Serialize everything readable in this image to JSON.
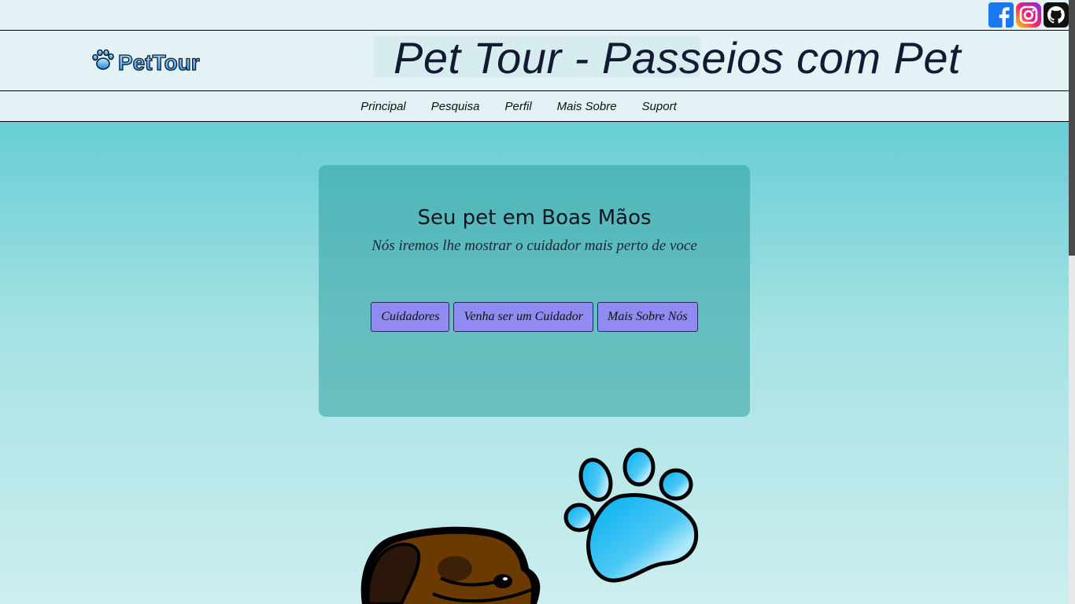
{
  "social": {
    "facebook_icon": "facebook-icon",
    "instagram_icon": "instagram-icon",
    "github_icon": "github-icon"
  },
  "header": {
    "logo_text": "PetTour",
    "title": "Pet Tour - Passeios com Pet"
  },
  "nav": {
    "items": [
      {
        "label": "Principal"
      },
      {
        "label": "Pesquisa"
      },
      {
        "label": "Perfil"
      },
      {
        "label": "Mais Sobre"
      },
      {
        "label": "Suport"
      }
    ]
  },
  "hero": {
    "heading": "Seu pet em Boas Mãos",
    "subheading": "Nós iremos lhe mostrar o cuidador mais perto de voce",
    "buttons": [
      {
        "label": "Cuidadores"
      },
      {
        "label": "Venha ser um Cuidador"
      },
      {
        "label": "Mais Sobre Nós"
      }
    ]
  },
  "colors": {
    "accent_button": "#8f8bf0",
    "paw_blue": "#1aa3f0",
    "background_top": "#4ac9d0",
    "header_bg": "#e3f3f5"
  }
}
